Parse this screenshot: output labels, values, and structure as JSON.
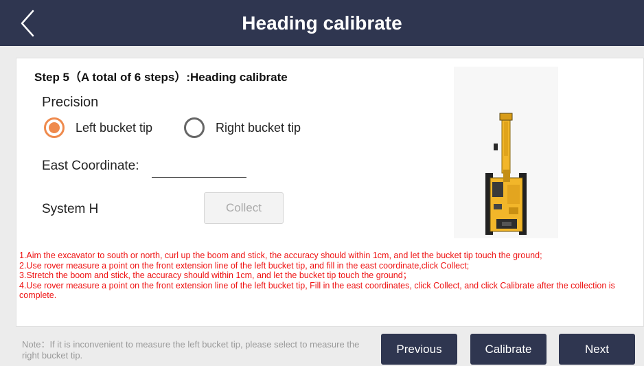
{
  "header": {
    "title": "Heading calibrate",
    "back_icon": "chevron-left-icon"
  },
  "step": {
    "title": "Step 5（A total of 6 steps）:Heading calibrate"
  },
  "precision": {
    "label": "Precision",
    "options": [
      {
        "label": "Left bucket tip",
        "selected": true
      },
      {
        "label": "Right bucket tip",
        "selected": false
      }
    ],
    "accent_color": "#ef8a4d"
  },
  "east_coordinate": {
    "label": "East Coordinate:",
    "value": ""
  },
  "system_h": {
    "label": "System H",
    "collect_label": "Collect"
  },
  "instructions": [
    "1.Aim the excavator to south or north, curl up the boom and stick, the accuracy should within 1cm, and let the bucket tip touch the ground;",
    "2.Use rover measure a point on the front extension line of the left bucket tip, and fill in the east coordinate,click Collect;",
    "3.Stretch the boom and stick, the accuracy should within 1cm, and let the bucket tip touch the ground；",
    "4.Use rover measure a point on the front extension line of the left bucket tip, Fill in the east coordinates, click Collect, and click Calibrate after the collection is complete."
  ],
  "note": "Note：If it is inconvenient to measure the left bucket tip, please select to measure the right bucket tip.",
  "buttons": {
    "previous": "Previous",
    "calibrate": "Calibrate",
    "next": "Next"
  },
  "colors": {
    "header_bg": "#2f3650",
    "instruction_text": "#ee1111",
    "excavator_body": "#f2b62a"
  }
}
